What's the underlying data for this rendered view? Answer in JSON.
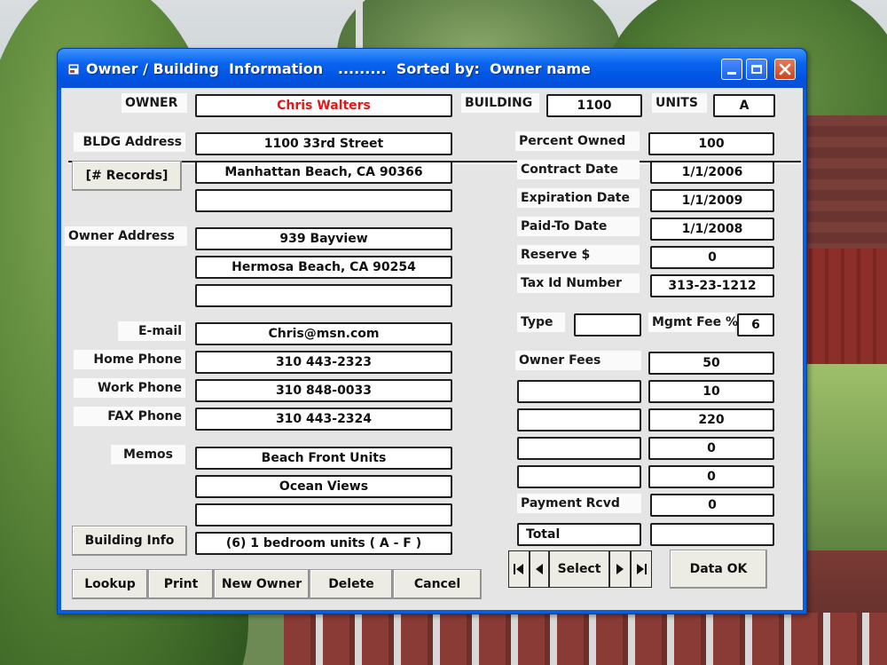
{
  "window": {
    "title": "Owner / Building  Information   .........  Sorted by:  Owner name"
  },
  "header": {
    "owner_label": "OWNER",
    "owner_value": "Chris Walters",
    "owner_value_color": "#e01818",
    "building_label": "BUILDING",
    "building_value": "1100",
    "units_label": "UNITS",
    "units_value": "A"
  },
  "left": {
    "bldg_address_label": "BLDG Address",
    "bldg_address": [
      "1100 33rd Street",
      "Manhattan Beach, CA 90366",
      ""
    ],
    "records_button": "[# Records]",
    "owner_address_label": "Owner Address",
    "owner_address": [
      "939 Bayview",
      "Hermosa Beach, CA 90254",
      ""
    ],
    "email_label": "E-mail",
    "email": "Chris@msn.com",
    "home_phone_label": "Home Phone",
    "home_phone": "310 443-2323",
    "work_phone_label": "Work Phone",
    "work_phone": "310 848-0033",
    "fax_phone_label": "FAX Phone",
    "fax_phone": "310 443-2324",
    "memos_label": "Memos",
    "memos": [
      "Beach Front Units",
      "Ocean Views",
      ""
    ],
    "building_info_button": "Building Info",
    "building_info": "(6) 1 bedroom units ( A - F )"
  },
  "right": {
    "percent_owned_label": "Percent Owned",
    "percent_owned": "100",
    "contract_date_label": "Contract   Date",
    "contract_date": "1/1/2006",
    "expiration_date_label": "Expiration Date",
    "expiration_date": "1/1/2009",
    "paid_to_date_label": "Paid-To   Date",
    "paid_to_date": "1/1/2008",
    "reserve_label": "Reserve $",
    "reserve": "0",
    "tax_id_label": "Tax Id Number",
    "tax_id": "313-23-1212",
    "type_label": "Type",
    "type_value": "",
    "mgmt_fee_label": "Mgmt Fee %",
    "mgmt_fee": "6",
    "owner_fees_label": "Owner Fees",
    "fee_rows": [
      {
        "label": "",
        "value": "50"
      },
      {
        "label": "",
        "value": "10"
      },
      {
        "label": "",
        "value": "220"
      },
      {
        "label": "",
        "value": "0"
      },
      {
        "label": "",
        "value": "0"
      }
    ],
    "payment_rcvd_label": "Payment Rcvd",
    "payment_rcvd": "0",
    "total_label": "Total",
    "total": ""
  },
  "toolbar": {
    "lookup": "Lookup",
    "print": "Print",
    "new_owner": "New Owner",
    "delete": "Delete",
    "cancel": "Cancel",
    "select": "Select",
    "data_ok": "Data  OK"
  },
  "icons": {
    "first": "first-record-icon",
    "prev": "prev-record-icon",
    "next": "next-record-icon",
    "last": "last-record-icon"
  }
}
